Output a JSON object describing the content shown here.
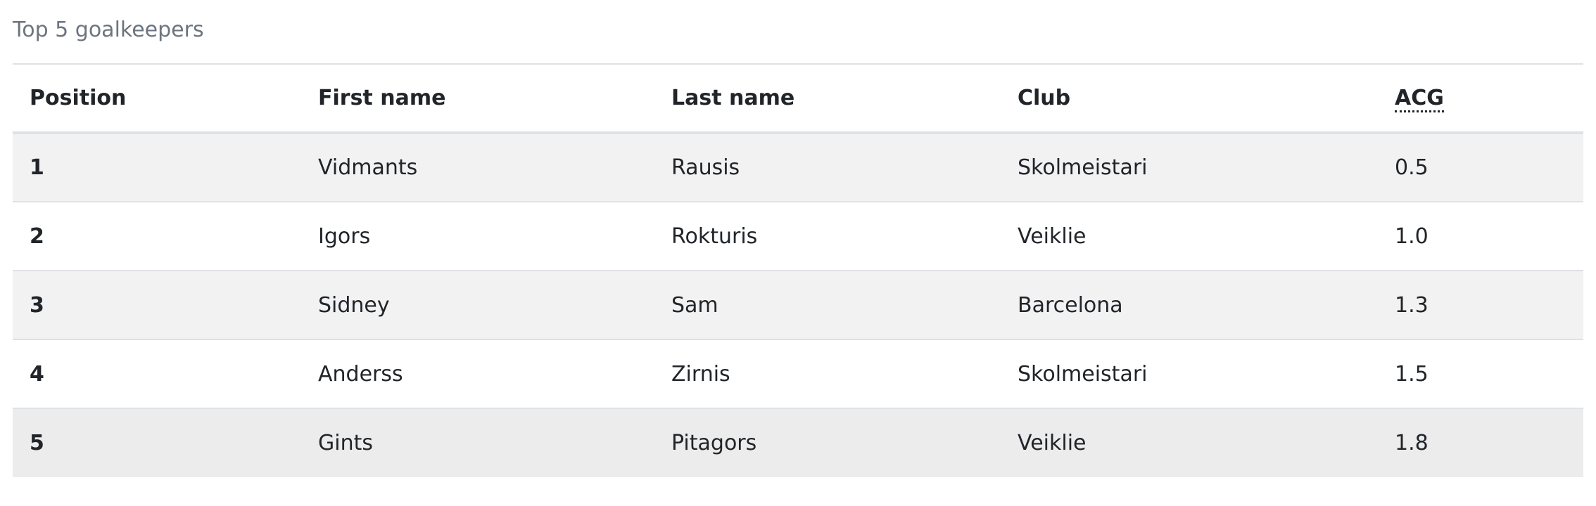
{
  "caption": "Top 5 goalkeepers",
  "table": {
    "headers": {
      "position": "Position",
      "first_name": "First name",
      "last_name": "Last name",
      "club": "Club",
      "acg": "ACG"
    },
    "rows": [
      {
        "position": "1",
        "first_name": "Vidmants",
        "last_name": "Rausis",
        "club": "Skolmeistari",
        "acg": "0.5"
      },
      {
        "position": "2",
        "first_name": "Igors",
        "last_name": "Rokturis",
        "club": "Veiklie",
        "acg": "1.0"
      },
      {
        "position": "3",
        "first_name": "Sidney",
        "last_name": "Sam",
        "club": "Barcelona",
        "acg": "1.3"
      },
      {
        "position": "4",
        "first_name": "Anderss",
        "last_name": "Zirnis",
        "club": "Skolmeistari",
        "acg": "1.5"
      },
      {
        "position": "5",
        "first_name": "Gints",
        "last_name": "Pitagors",
        "club": "Veiklie",
        "acg": "1.8"
      }
    ]
  },
  "colors": {
    "caption_text": "#6c757d",
    "body_text": "#212529",
    "stripe": "#f2f2f2",
    "border": "#dee2e6"
  }
}
